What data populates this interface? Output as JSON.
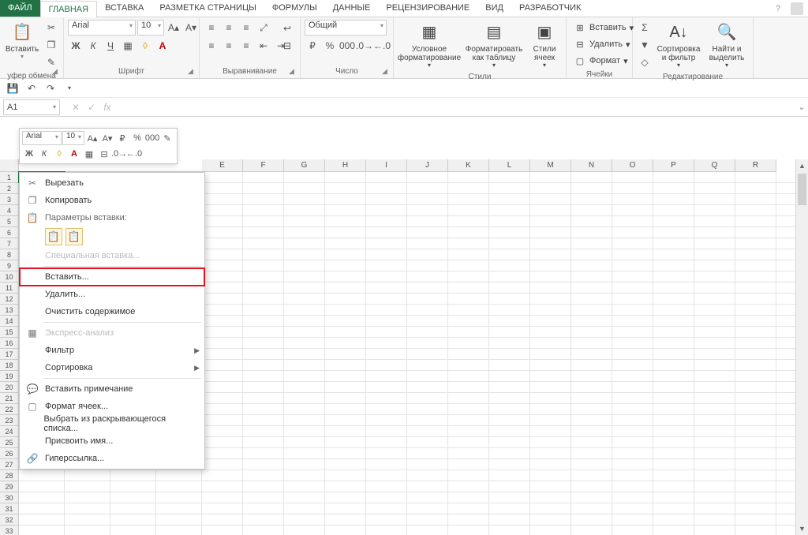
{
  "tabs": {
    "file": "ФАЙЛ",
    "items": [
      "ГЛАВНАЯ",
      "ВСТАВКА",
      "РАЗМЕТКА СТРАНИЦЫ",
      "ФОРМУЛЫ",
      "ДАННЫЕ",
      "РЕЦЕНЗИРОВАНИЕ",
      "ВИД",
      "РАЗРАБОТЧИК"
    ],
    "active_index": 0
  },
  "ribbon": {
    "clipboard": {
      "paste": "Вставить",
      "label": "уфер обмена"
    },
    "font": {
      "name": "Arial",
      "size": "10",
      "label": "Шрифт"
    },
    "alignment": {
      "label": "Выравнивание"
    },
    "number": {
      "format": "Общий",
      "label": "Число"
    },
    "styles": {
      "cond": "Условное форматирование",
      "table": "Форматировать как таблицу",
      "cell": "Стили ячеек",
      "label": "Стили"
    },
    "cells": {
      "insert": "Вставить",
      "delete": "Удалить",
      "format": "Формат",
      "label": "Ячейки"
    },
    "editing": {
      "sort": "Сортировка и фильтр",
      "find": "Найти и выделить",
      "label": "Редактирование"
    }
  },
  "namebox": "A1",
  "mini": {
    "font": "Arial",
    "size": "10"
  },
  "columns": [
    "E",
    "F",
    "G",
    "H",
    "I",
    "J",
    "K",
    "L",
    "M",
    "N",
    "O",
    "P",
    "Q",
    "R"
  ],
  "row_count": 33,
  "ctx": {
    "cut": "Вырезать",
    "copy": "Копировать",
    "paste_opts_hdr": "Параметры вставки:",
    "paste_special": "Специальная вставка...",
    "insert": "Вставить...",
    "delete": "Удалить...",
    "clear": "Очистить содержимое",
    "quick": "Экспресс-анализ",
    "filter": "Фильтр",
    "sort": "Сортировка",
    "comment": "Вставить примечание",
    "format": "Формат ячеек...",
    "dropdown": "Выбрать из раскрывающегося списка...",
    "name": "Присвоить имя...",
    "hyperlink": "Гиперссылка..."
  }
}
